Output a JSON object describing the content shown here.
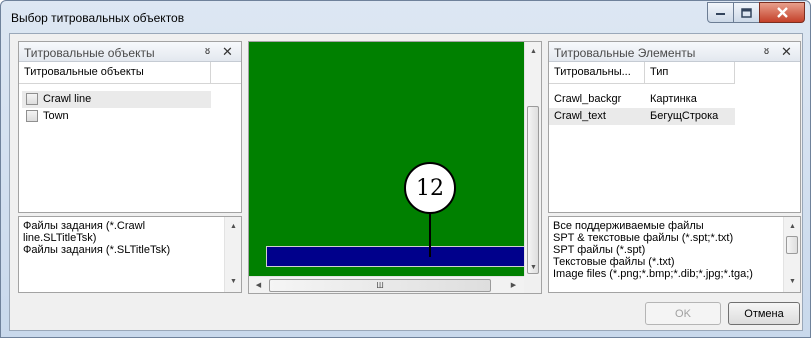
{
  "window": {
    "title": "Выбор титровальных объектов"
  },
  "left_panel": {
    "title": "Титровальные объекты",
    "column": "Титровальные объекты",
    "items": [
      {
        "label": "Crawl line",
        "checked": false,
        "selected": true
      },
      {
        "label": "Town",
        "checked": false,
        "selected": false
      }
    ]
  },
  "left_files": {
    "lines": [
      "Файлы задания (*.Crawl",
      "line.SLTitleTsk)",
      "Файлы задания (*.SLTitleTsk)"
    ]
  },
  "preview": {
    "callout_number": "12"
  },
  "right_panel": {
    "title": "Титровальные Элементы",
    "columns": [
      "Титровальны...",
      "Тип"
    ],
    "rows": [
      {
        "name": "Crawl_backgr",
        "type": "Картинка",
        "selected": false
      },
      {
        "name": "Crawl_text",
        "type": "БегущСтрока",
        "selected": true
      }
    ]
  },
  "right_files": {
    "lines": [
      "Все поддерживаемые файлы",
      "SPT & текстовые файлы (*.spt;*.txt)",
      "SPT файлы (*.spt)",
      "Текстовые файлы (*.txt)",
      "Image files (*.png;*.bmp;*.dib;*.jpg;*.tga;)"
    ]
  },
  "buttons": {
    "ok": "OK",
    "cancel": "Отмена"
  },
  "icons": {
    "pin": "pin-icon",
    "close": "close-icon",
    "minimize": "minimize-icon",
    "maximize": "maximize-icon",
    "hscroll_mark": "Ш"
  },
  "colors": {
    "canvas": "#008000",
    "bar": "#00008b"
  }
}
